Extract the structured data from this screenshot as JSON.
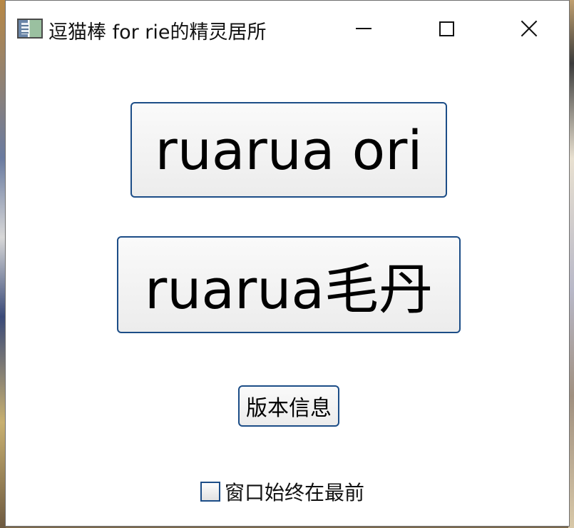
{
  "window": {
    "title": "逗猫棒 for rie的精灵居所"
  },
  "buttons": {
    "ori_label": "ruarua ori",
    "maodan_label": "ruarua毛丹",
    "version_label": "版本信息"
  },
  "options": {
    "always_on_top_label": "窗口始终在最前",
    "always_on_top_checked": false
  }
}
